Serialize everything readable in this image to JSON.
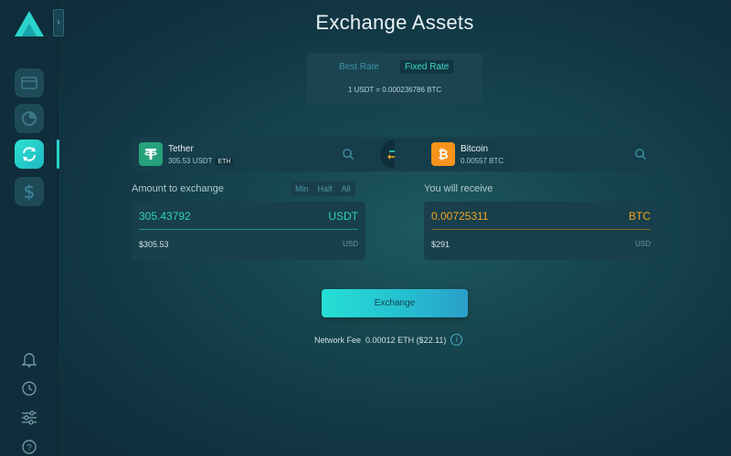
{
  "sidebar": {
    "items": [
      {
        "icon": "wallet-icon",
        "active": false
      },
      {
        "icon": "portfolio-chart-icon",
        "active": false
      },
      {
        "icon": "exchange-icon",
        "active": true
      },
      {
        "icon": "dollar-icon",
        "active": false
      }
    ],
    "bottom": [
      "bell-icon",
      "history-icon",
      "settings-sliders-icon",
      "help-icon"
    ],
    "collapse_glyph": "›"
  },
  "page": {
    "title": "Exchange Assets"
  },
  "rate": {
    "tabs": [
      "Best Rate",
      "Fixed Rate"
    ],
    "selected": "Fixed Rate",
    "text": "1 USDT = 0.000236786 BTC"
  },
  "from_asset": {
    "name": "Tether",
    "balance": "305.53 USDT",
    "chain": "ETH",
    "icon": "tether-icon",
    "color": "#26a17b"
  },
  "to_asset": {
    "name": "Bitcoin",
    "balance": "0.00557 BTC",
    "icon": "bitcoin-icon",
    "color": "#f7931a"
  },
  "send": {
    "label": "Amount to exchange",
    "buttons": [
      "Min",
      "Half",
      "All"
    ],
    "amount": "305.43792",
    "currency": "USDT",
    "usd_value": "$305.53",
    "usd_label": "USD"
  },
  "receive": {
    "label": "You will receive",
    "amount": "0.00725311",
    "currency": "BTC",
    "usd_value": "$291",
    "usd_label": "USD"
  },
  "exchange_button": "Exchange",
  "fee": {
    "label": "Network Fee",
    "value": "0.00012 ETH ($22.11)"
  },
  "colors": {
    "accent": "#2bd3cc",
    "send_value": "#31d3b5",
    "receive_value": "#f2a51f"
  }
}
